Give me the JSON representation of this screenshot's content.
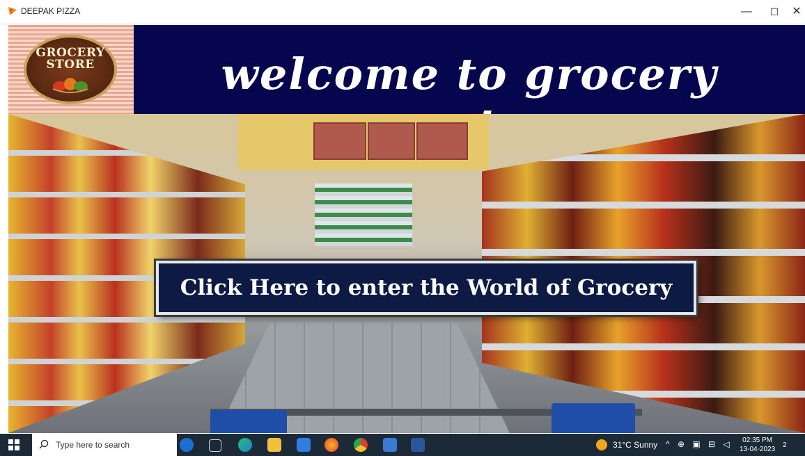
{
  "window": {
    "title": "DEEPAK PIZZA",
    "min_label": "—",
    "max_label": "☐",
    "close_label": "✕"
  },
  "header": {
    "logo_line1": "GROCERY",
    "logo_line2": "STORE",
    "welcome": "welcome to grocery center"
  },
  "main": {
    "enter_button": "Click Here to enter the World of Grocery"
  },
  "taskbar": {
    "search_placeholder": "Type here to search",
    "weather": "31°C  Sunny",
    "time": "02:35 PM",
    "date": "13-04-2023",
    "notification_count": "2"
  },
  "colors": {
    "header_bg": "#06064f",
    "button_bg": "#0d1b44",
    "taskbar_bg": "#1b2a36"
  }
}
